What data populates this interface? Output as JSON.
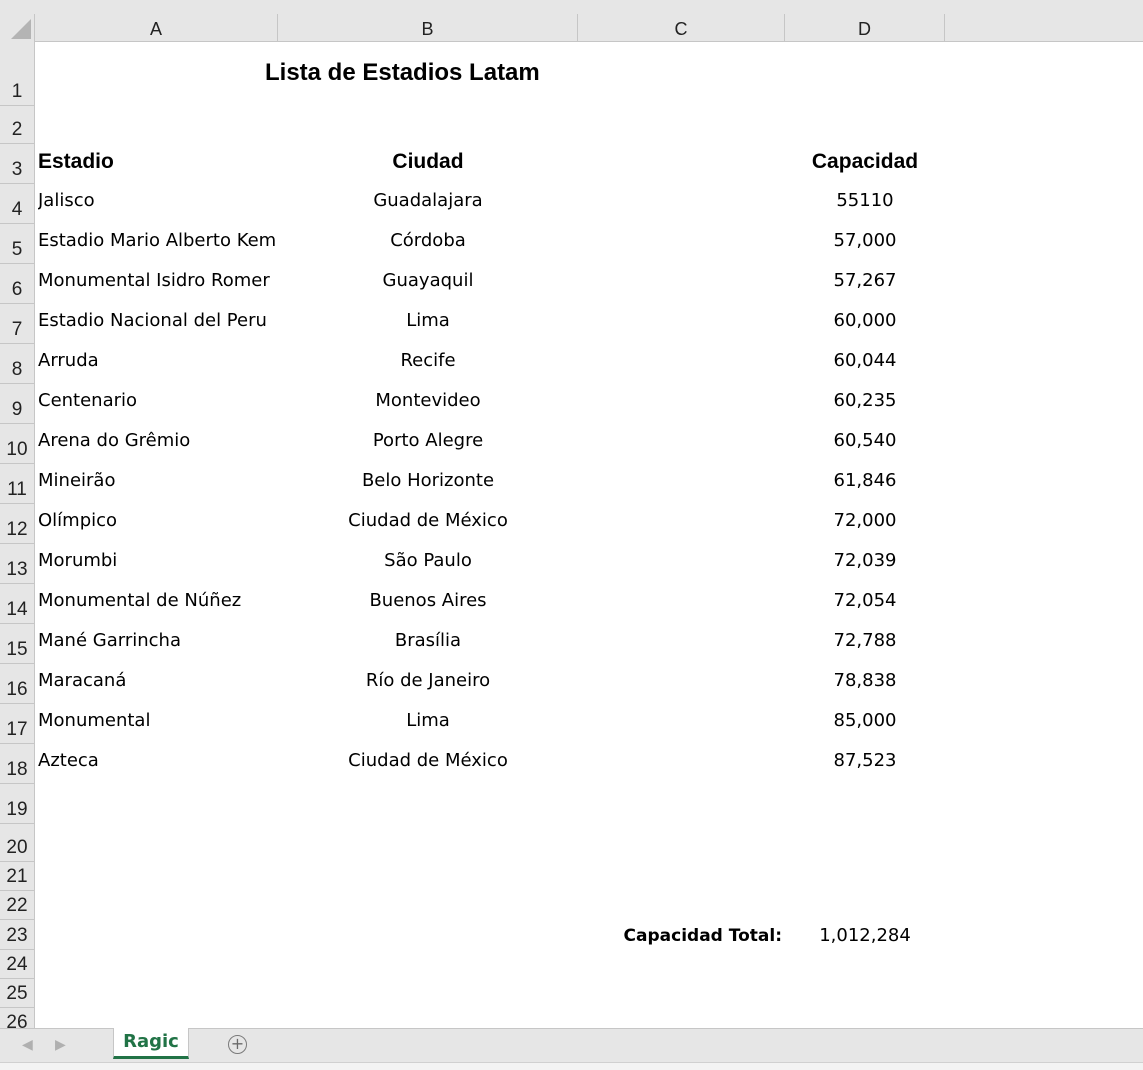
{
  "columns": [
    "A",
    "B",
    "C",
    "D"
  ],
  "rows": [
    "1",
    "2",
    "3",
    "4",
    "5",
    "6",
    "7",
    "8",
    "9",
    "10",
    "11",
    "12",
    "13",
    "14",
    "15",
    "16",
    "17",
    "18",
    "19",
    "20",
    "21",
    "22",
    "23",
    "24",
    "25",
    "26"
  ],
  "sheet": {
    "title": "Lista de Estadios Latam",
    "headers": {
      "estadio": "Estadio",
      "ciudad": "Ciudad",
      "capacidad": "Capacidad"
    },
    "records": [
      {
        "estadio": "Jalisco",
        "ciudad": "Guadalajara",
        "capacidad": "55110"
      },
      {
        "estadio": "Estadio Mario Alberto Kem",
        "ciudad": "Córdoba",
        "capacidad": "57,000"
      },
      {
        "estadio": "Monumental Isidro Romer",
        "ciudad": "Guayaquil",
        "capacidad": "57,267"
      },
      {
        "estadio": "Estadio Nacional del Peru",
        "ciudad": "Lima",
        "capacidad": "60,000"
      },
      {
        "estadio": "Arruda",
        "ciudad": "Recife",
        "capacidad": "60,044"
      },
      {
        "estadio": "Centenario",
        "ciudad": "Montevideo",
        "capacidad": "60,235"
      },
      {
        "estadio": "Arena do Grêmio",
        "ciudad": "Porto Alegre",
        "capacidad": "60,540"
      },
      {
        "estadio": "Mineirão",
        "ciudad": "Belo Horizonte",
        "capacidad": "61,846"
      },
      {
        "estadio": "Olímpico",
        "ciudad": "Ciudad de México",
        "capacidad": "72,000"
      },
      {
        "estadio": "Morumbi",
        "ciudad": "São Paulo",
        "capacidad": "72,039"
      },
      {
        "estadio": "Monumental de Núñez",
        "ciudad": "Buenos Aires",
        "capacidad": "72,054"
      },
      {
        "estadio": "Mané Garrincha",
        "ciudad": "Brasília",
        "capacidad": "72,788"
      },
      {
        "estadio": "Maracaná",
        "ciudad": "Río de Janeiro",
        "capacidad": "78,838"
      },
      {
        "estadio": "Monumental",
        "ciudad": "Lima",
        "capacidad": "85,000"
      },
      {
        "estadio": "Azteca",
        "ciudad": "Ciudad de México",
        "capacidad": "87,523"
      }
    ],
    "total_label": "Capacidad Total:",
    "total_value": "1,012,284"
  },
  "tabs": {
    "active": "Ragic",
    "prev_icon": "chevron-left-icon",
    "next_icon": "chevron-right-icon",
    "add_icon": "plus-circle-icon"
  },
  "colors": {
    "tab_accent": "#217346",
    "header_bg": "#e6e6e6",
    "gridline": "#c6c6c6"
  }
}
